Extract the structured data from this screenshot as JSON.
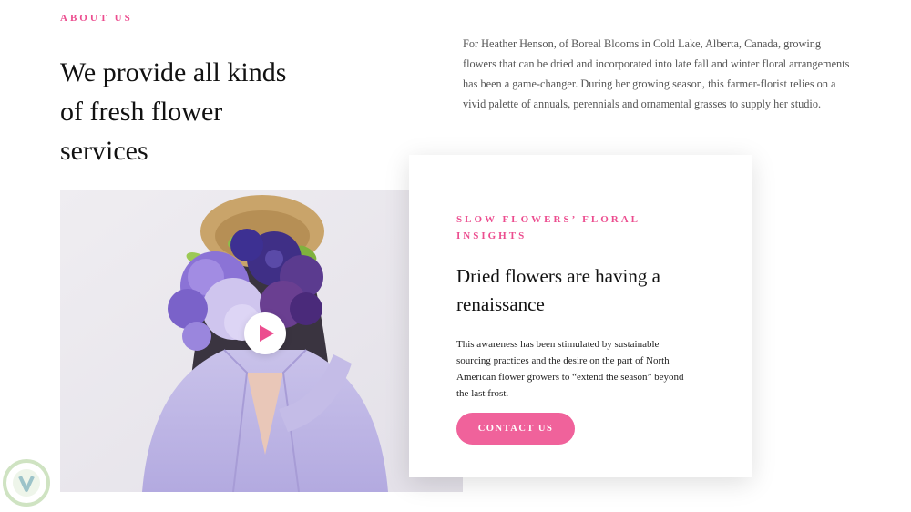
{
  "about": {
    "eyebrow": "ABOUT US",
    "headline": "We provide all kinds of fresh flower services",
    "intro": "For Heather Henson, of Boreal Blooms in Cold Lake, Alberta, Canada, growing flowers that can be dried and incorporated into late fall and winter floral arrangements has been a game-changer. During her growing season, this farmer-florist relies on a vivid palette of annuals, perennials and ornamental grasses to supply her studio."
  },
  "media": {
    "image_icon": "woman-with-bouquet-photo",
    "play_icon": "play-icon"
  },
  "card": {
    "eyebrow": "SLOW FLOWERS’ FLORAL INSIGHTS",
    "title": "Dried flowers are having a renaissance",
    "text": "This awareness has been stimulated by sustainable sourcing practices and the desire on the part of North American flower growers to “extend the season” beyond the last frost.",
    "cta_label": "CONTACT US"
  },
  "colors": {
    "accent": "#ec4d8f",
    "button": "#f0629b",
    "body_text": "#555555"
  }
}
